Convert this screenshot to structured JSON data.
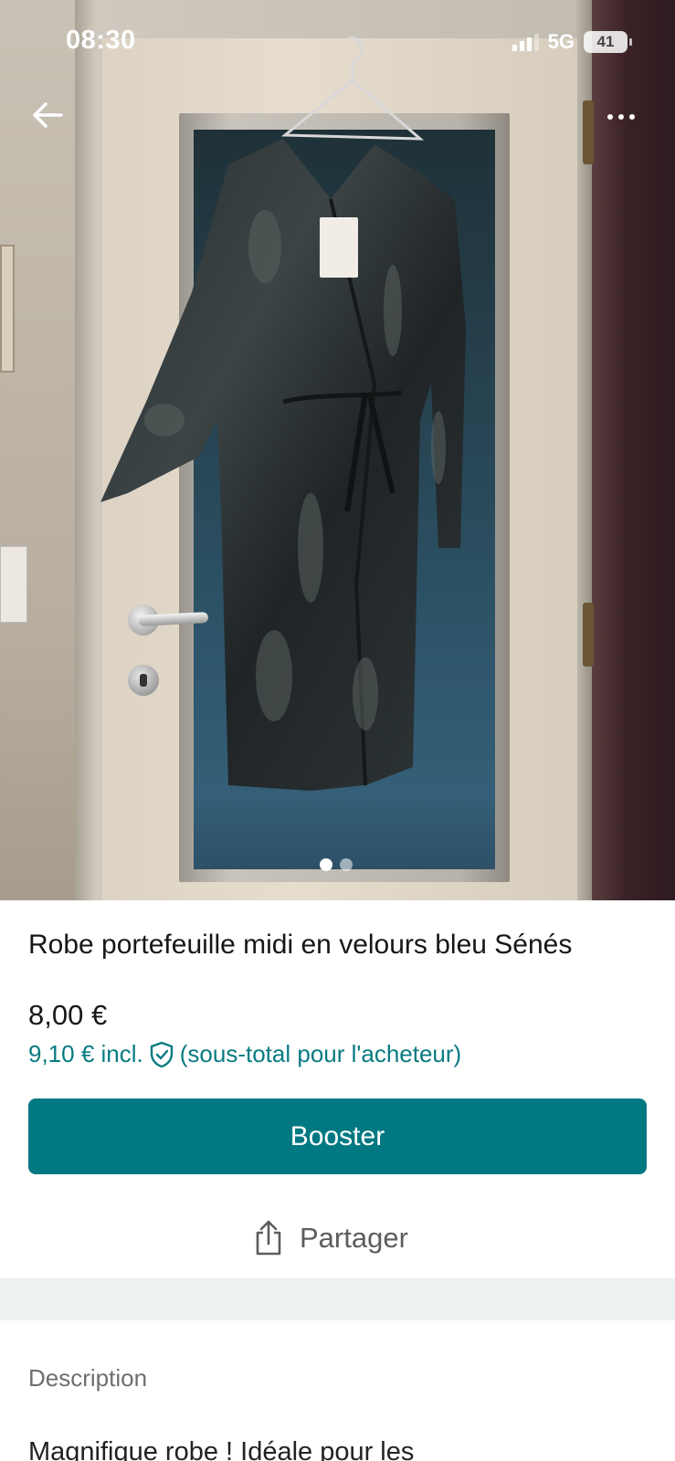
{
  "status_bar": {
    "time": "08:30",
    "network": "5G",
    "battery": "41"
  },
  "gallery": {
    "image_count": 2,
    "active_index": 0
  },
  "item": {
    "title": "Robe portefeuille midi en velours bleu Sénés",
    "price": "8,00 €",
    "price_incl": "9,10 € incl.",
    "price_incl_note": "(sous-total pour l'acheteur)"
  },
  "actions": {
    "boost_label": "Booster",
    "share_label": "Partager"
  },
  "description": {
    "heading": "Description",
    "text": "Magnifique robe ! Idéale pour les"
  },
  "colors": {
    "accent": "#027882",
    "accent_text": "#087b82"
  },
  "icons": {
    "back": "arrow-left-icon",
    "more": "more-dots-icon",
    "shield": "shield-check-icon",
    "share": "share-icon"
  }
}
